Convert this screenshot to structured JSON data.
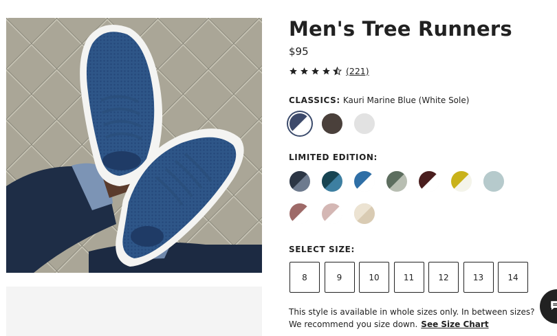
{
  "product": {
    "title": "Men's Tree Runners",
    "price": "$95",
    "rating_value": 4.5,
    "review_count": "(221)"
  },
  "classics": {
    "label": "CLASSICS:",
    "selected_color": "Kauri Marine Blue (White Sole)",
    "swatches": [
      {
        "name": "kauri-marine-blue-white-sole",
        "colors": [
          "#3d4a6b",
          "#ffffff"
        ],
        "selected": true
      },
      {
        "name": "dark-brown",
        "colors": [
          "#4a403b",
          "#4a403b"
        ]
      },
      {
        "name": "light-grey",
        "colors": [
          "#e2e2e2",
          "#e2e2e2"
        ]
      }
    ]
  },
  "limited": {
    "label": "LIMITED EDITION:",
    "swatches": [
      {
        "name": "charcoal-navy",
        "colors": [
          "#2c3645",
          "#6d7a8e"
        ]
      },
      {
        "name": "deep-teal",
        "colors": [
          "#174452",
          "#3d7fa1"
        ]
      },
      {
        "name": "blue-white",
        "colors": [
          "#2f6fa6",
          "#ffffff"
        ]
      },
      {
        "name": "sage-green",
        "colors": [
          "#5d6e5f",
          "#b8beb2"
        ]
      },
      {
        "name": "maroon-white",
        "colors": [
          "#4a1e1e",
          "#ffffff"
        ]
      },
      {
        "name": "mustard-white",
        "colors": [
          "#c9b21a",
          "#f4f4ea"
        ]
      },
      {
        "name": "pale-blue",
        "colors": [
          "#b6cacc",
          "#b6cacc"
        ]
      },
      {
        "name": "rose-white",
        "colors": [
          "#9e6a68",
          "#ffffff"
        ]
      },
      {
        "name": "blush-white",
        "colors": [
          "#d4b7b4",
          "#ffffff"
        ]
      },
      {
        "name": "cream-print",
        "colors": [
          "#ece3d2",
          "#d9cbb3"
        ]
      }
    ]
  },
  "sizes": {
    "label": "SELECT SIZE:",
    "options": [
      "8",
      "9",
      "10",
      "11",
      "12",
      "13",
      "14"
    ],
    "note": "This style is available in whole sizes only. In between sizes? We recommend you size down.",
    "size_chart_link": "See Size Chart"
  },
  "icons": {
    "star": "star-icon",
    "chat": "chat-icon"
  },
  "colors": {
    "text": "#212121",
    "selected_ring": "#3a4a6b",
    "image_background": "#a9a595"
  }
}
